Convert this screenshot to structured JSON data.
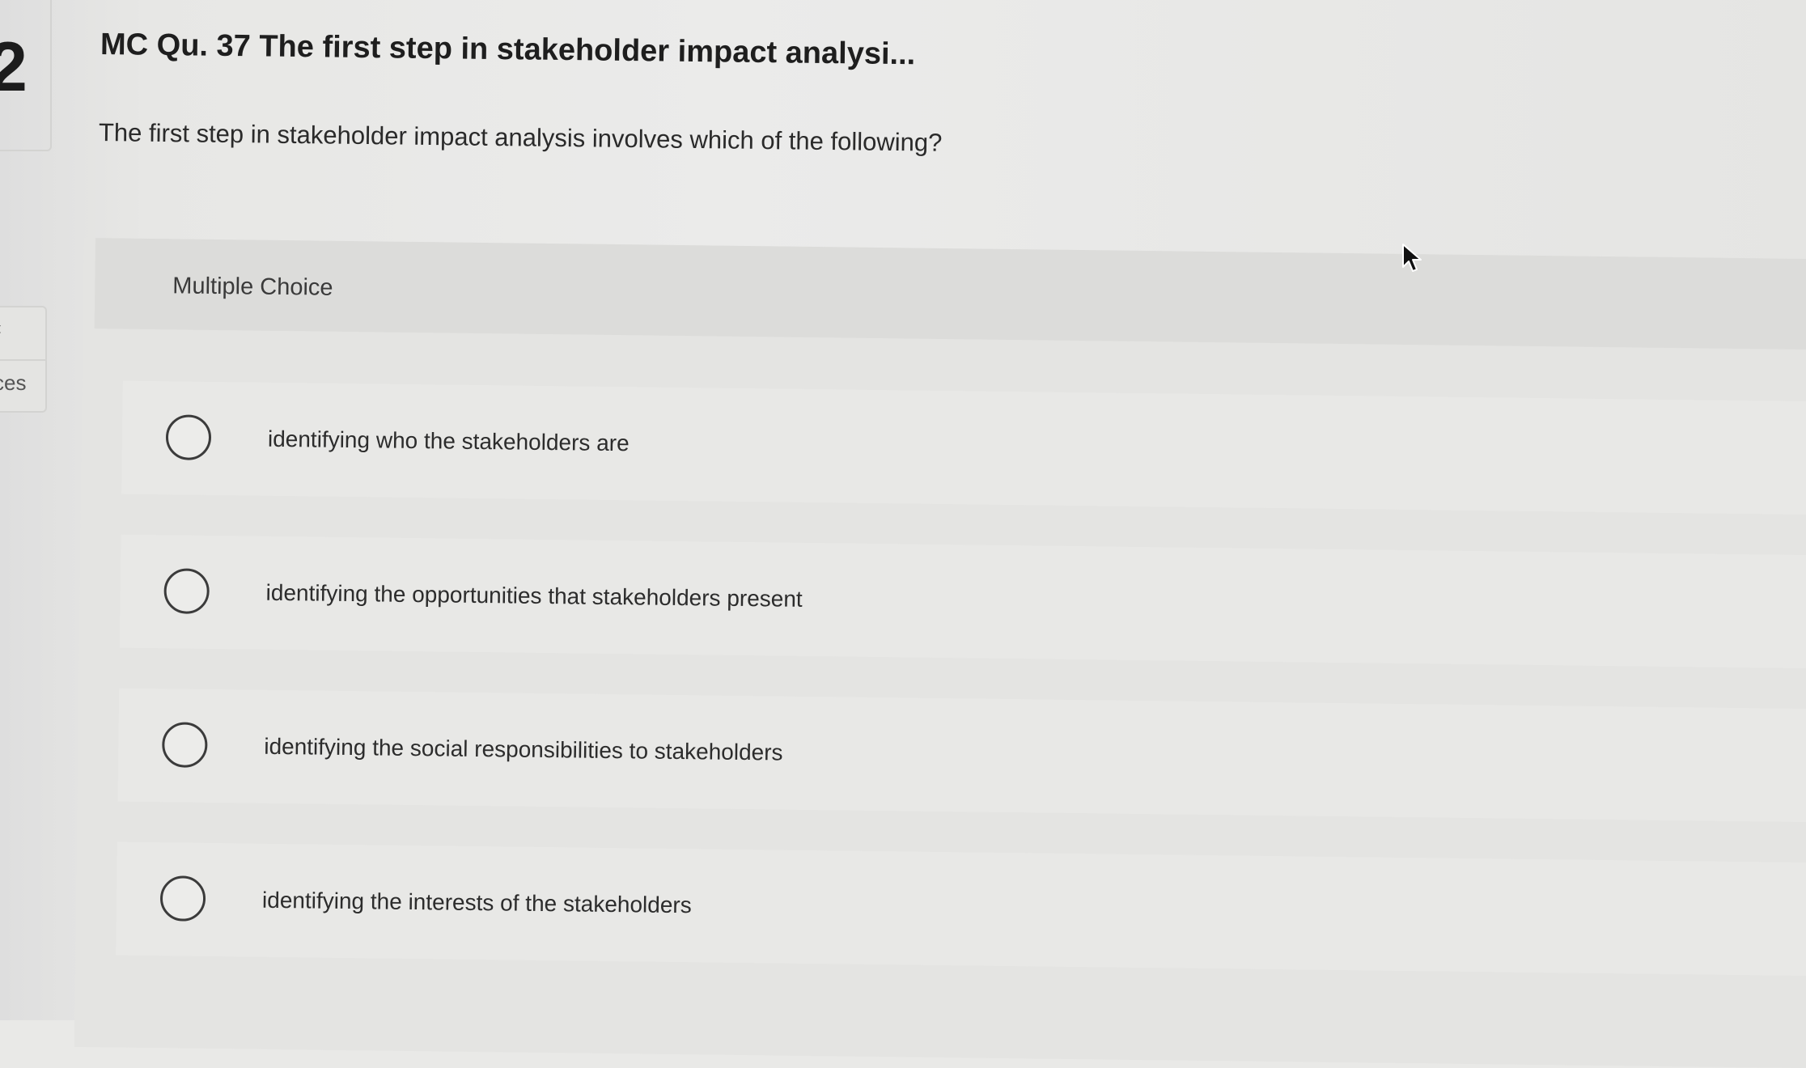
{
  "sidebar": {
    "question_number_fragment": "2",
    "nav_fragment": "‹",
    "resources_fragment": "ces"
  },
  "question": {
    "title": "MC Qu. 37 The first step in stakeholder impact analysi...",
    "prompt": "The first step in stakeholder impact analysis involves which of the following?"
  },
  "multiple_choice": {
    "header_label": "Multiple Choice",
    "options": [
      {
        "label": "identifying who the stakeholders are",
        "selected": false
      },
      {
        "label": "identifying the opportunities that stakeholders present",
        "selected": false
      },
      {
        "label": "identifying the social responsibilities to stakeholders",
        "selected": false
      },
      {
        "label": "identifying the interests of the stakeholders",
        "selected": false
      }
    ]
  },
  "icons": {
    "cursor": "mouse-pointer-icon",
    "radio": "radio-unchecked-icon"
  }
}
